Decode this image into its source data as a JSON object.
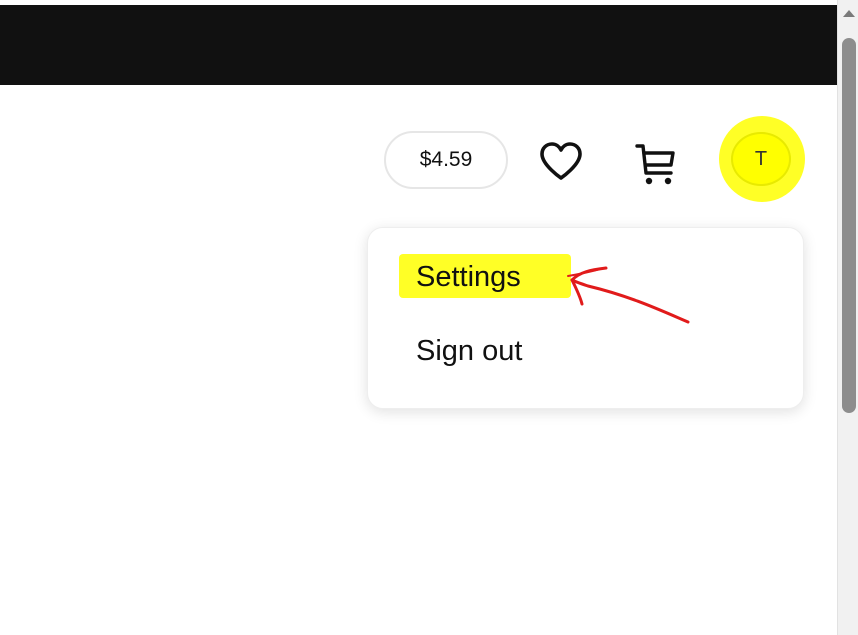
{
  "header": {
    "credit_balance": "$4.59",
    "favorites_icon": "heart-icon",
    "cart_icon": "cart-icon",
    "avatar_initial": "T"
  },
  "account_menu": {
    "items": [
      {
        "label": "Settings"
      },
      {
        "label": "Sign out"
      }
    ]
  },
  "annotations": {
    "highlight_color": "#ffff26",
    "arrow_color": "#e11b1b"
  },
  "colors": {
    "top_bar": "#111111",
    "page_background": "#ffffff",
    "text": "#111111"
  }
}
